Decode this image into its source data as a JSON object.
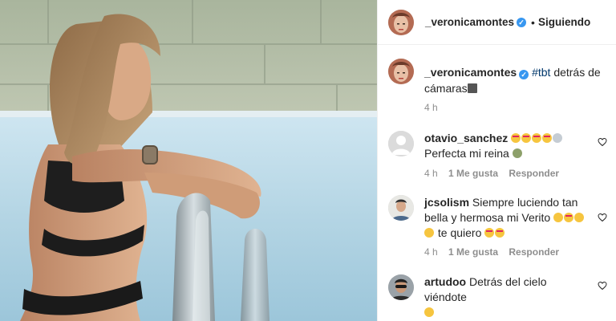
{
  "header": {
    "username": "_veronicamontes",
    "dot": "•",
    "follow_label": "Siguiendo"
  },
  "caption": {
    "username": "_veronicamontes",
    "hashtag": "#tbt",
    "text": "detrás de cámaras",
    "time": "4 h"
  },
  "comments": [
    {
      "username": "otavio_sanchez",
      "text": "Perfecta mi reina",
      "time": "4 h",
      "likes": "1 Me gusta",
      "reply": "Responder"
    },
    {
      "username": "jcsolism",
      "text": "Siempre luciendo tan bella y hermosa mi Verito",
      "text2": "te quiero",
      "time": "4 h",
      "likes": "1 Me gusta",
      "reply": "Responder"
    },
    {
      "username": "artudoo",
      "text": "Detrás del cielo viéndote",
      "time": "",
      "likes": "",
      "reply": ""
    }
  ],
  "icons": {
    "verified": "verified-badge-icon",
    "heart": "heart-outline-icon",
    "more": "more-options-icon"
  },
  "colors": {
    "verified": "#3897f0",
    "hashtag": "#00376b",
    "muted": "#8e8e8e",
    "text": "#262626"
  }
}
